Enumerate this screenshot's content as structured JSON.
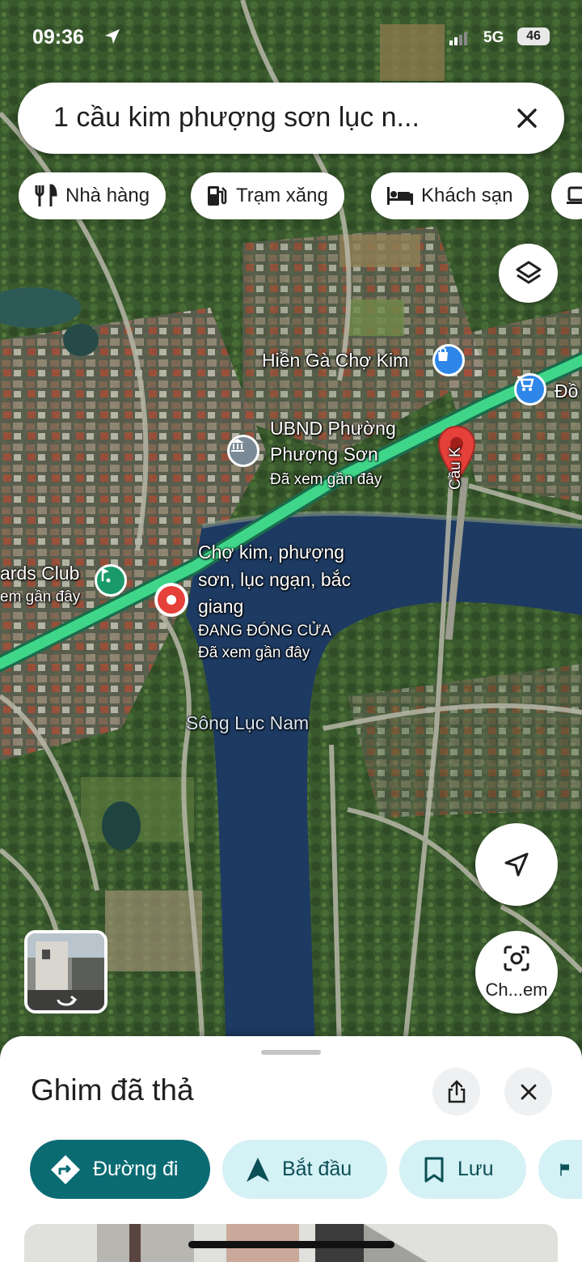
{
  "status_bar": {
    "time": "09:36",
    "network": "5G",
    "battery": "46"
  },
  "search": {
    "query": "1 cầu kim phượng sơn lục n...",
    "clear_icon": "close-icon"
  },
  "chips": [
    {
      "label": "Nhà hàng",
      "icon": "restaurant-icon"
    },
    {
      "label": "Trạm xăng",
      "icon": "gas-station-icon"
    },
    {
      "label": "Khách sạn",
      "icon": "hotel-icon"
    }
  ],
  "map": {
    "labels": {
      "hien_ga": "Hiền Gà Chợ Kim",
      "do_partial": "Đồ",
      "ubnd_1": "UBND Phường",
      "ubnd_2": "Phượng Sơn",
      "ubnd_sub": "Đã xem gần đây",
      "club": "ards Club",
      "club_sub": "em gần đây",
      "cho_1": "Chợ kim, phượng",
      "cho_2": "sơn, lục ngạn, bắc",
      "cho_3": "giang",
      "cho_status": "ĐANG ĐÓNG CỬA",
      "cho_sub": "Đã xem gần đây",
      "river": "Sông Lục Nam",
      "bridge": "Cầu K"
    }
  },
  "lens": {
    "label": "Ch...em"
  },
  "sheet": {
    "title": "Ghim đã thả",
    "actions": [
      {
        "label": "Đường đi",
        "icon": "directions-icon"
      },
      {
        "label": "Bắt đầu",
        "icon": "navigation-arrow-icon"
      },
      {
        "label": "Lưu",
        "icon": "bookmark-icon"
      }
    ]
  },
  "colors": {
    "primary_action": "#0b6b73",
    "secondary_action": "#d4f1f5",
    "road_highlight": "#3fd68a",
    "pin_red": "#e5403a",
    "poi_blue": "#2e86e8",
    "poi_green": "#1a9a6c",
    "poi_gray": "#7a8a96"
  }
}
